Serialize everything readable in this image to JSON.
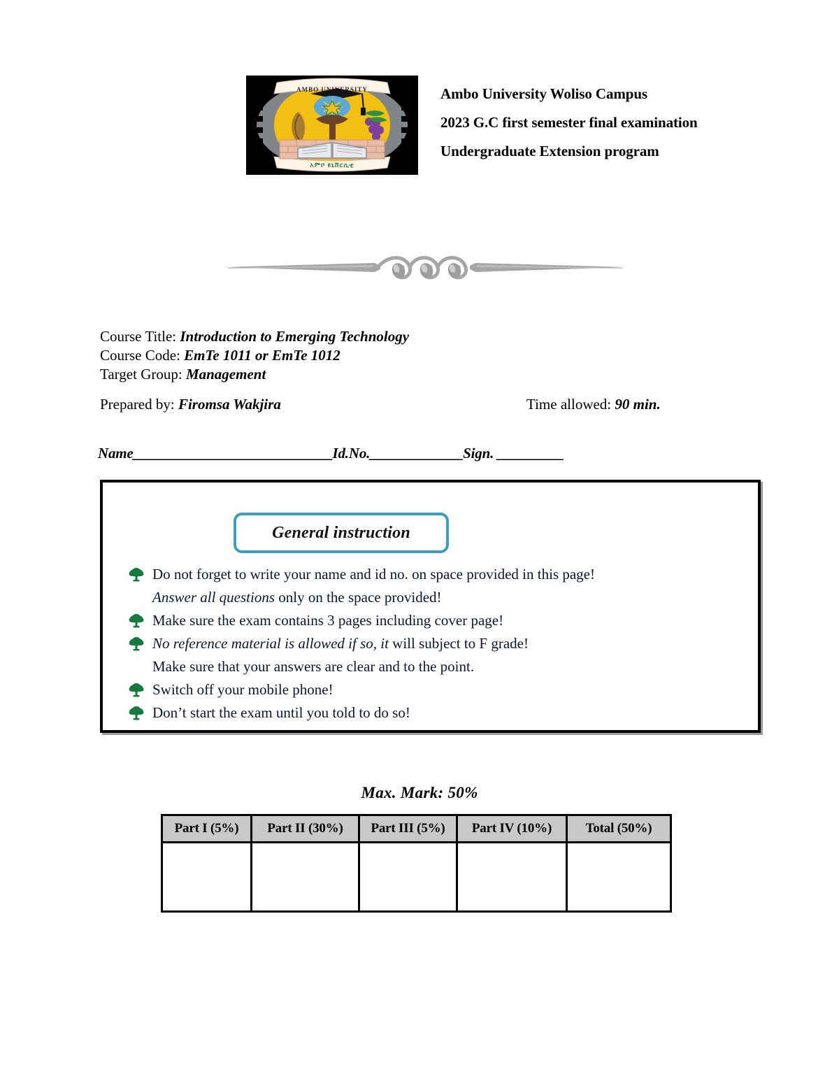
{
  "document": {
    "page_background": "#ffffff",
    "accent_teal": "#3e9fbd",
    "bullet_green": "#157a3c",
    "header_gray": "#c8c8c8"
  },
  "header": {
    "logo_alt": "Ambo University emblem",
    "logo_top_text": "AMBO UNIVERSITY",
    "logo_bottom_text": "አምቦ ዩኒቨርሲቲ",
    "lines": [
      "Ambo University Woliso Campus",
      "2023 G.C first semester final examination",
      "Undergraduate Extension program"
    ]
  },
  "ornament": {
    "name": "decorative-divider",
    "color": "#a6a6a6"
  },
  "course_info": {
    "rows": [
      {
        "label": "Course Title: ",
        "value": "Introduction to Emerging Technology"
      },
      {
        "label": "Course Code: ",
        "value": "EmTe 1011 or EmTe 1012"
      },
      {
        "label": "Target Group: ",
        "value": "Management"
      }
    ],
    "prepared_by_label": "Prepared by: ",
    "prepared_by_value": "Firomsa Wakjira",
    "time_allowed_label": "Time allowed: ",
    "time_allowed_value": "90 min."
  },
  "identity_line": {
    "name_label": "Name",
    "name_blank": "______________________________",
    "id_label": "Id.No.",
    "id_blank": "______________",
    "sign_label": "Sign. ",
    "sign_blank": "__________"
  },
  "instructions": {
    "title": "General instruction",
    "items": [
      {
        "bullet": true,
        "text": "Do not forget to write your name and id no. on space provided in this page!",
        "italic": false
      },
      {
        "bullet": false,
        "text_italic": "Answer all questions",
        "text": " only on the space provided!",
        "italic": "partial"
      },
      {
        "bullet": true,
        "text": "Make sure the exam contains 3 pages including cover page!",
        "italic": false
      },
      {
        "bullet": true,
        "text_italic": "No reference material is allowed if so, it",
        "text": " will subject to F grade!",
        "italic": "partial"
      },
      {
        "bullet": false,
        "text": "Make sure that your answers are clear and to the point.",
        "italic": true
      },
      {
        "bullet": true,
        "text": "Switch off your mobile phone!",
        "italic": false
      },
      {
        "bullet": true,
        "text": "Don’t start the exam until you told to do so!",
        "italic": false
      }
    ]
  },
  "marks": {
    "max_mark": "Max. Mark: 50%",
    "columns": [
      "Part I (5%)",
      "Part II (30%)",
      "Part III (5%)",
      "Part IV (10%)",
      "Total (50%)"
    ],
    "values": [
      "",
      "",
      "",
      "",
      ""
    ]
  }
}
